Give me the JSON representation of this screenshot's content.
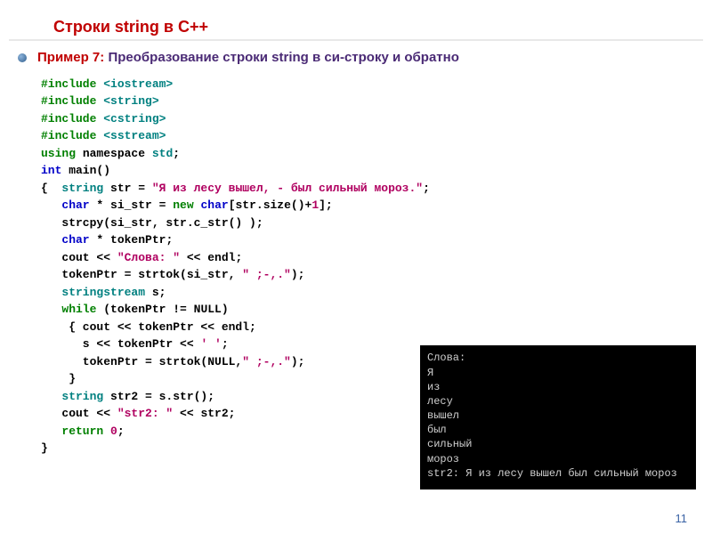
{
  "title": "Строки  string в С++",
  "example": {
    "label": "Пример 7: ",
    "text": "Преобразование строки string в си-строку и обратно"
  },
  "code": {
    "l1a": "#include ",
    "l1b": "<iostream>",
    "l2a": "#include ",
    "l2b": "<string>",
    "l3a": "#include ",
    "l3b": "<cstring>",
    "l4a": "#include ",
    "l4b": "<sstream>",
    "l5a": "using",
    "l5b": " namespace ",
    "l5c": "std",
    "l5d": ";",
    "l6a": "int",
    "l6b": " main()",
    "l7a": "{  ",
    "l7b": "string",
    "l7c": " str = ",
    "l7d": "\"Я из лесу вышел, - был сильный мороз.\"",
    "l7e": ";",
    "l8a": "   ",
    "l8b": "char",
    "l8c": " * si_str = ",
    "l8d": "new",
    "l8e": " ",
    "l8f": "char",
    "l8g": "[str.size()+",
    "l8h": "1",
    "l8i": "];",
    "l9a": "   strcpy(si_str, str.c_str() );",
    "l10a": "   ",
    "l10b": "char",
    "l10c": " * tokenPtr;",
    "l11a": "   cout << ",
    "l11b": "\"Слова: \"",
    "l11c": " << endl;",
    "l12a": "   tokenPtr = strtok(si_str, ",
    "l12b": "\" ;-,.\"",
    "l12c": ");",
    "l13a": "   ",
    "l13b": "stringstream",
    "l13c": " s;",
    "l14a": "   ",
    "l14b": "while",
    "l14c": " (tokenPtr != NULL)",
    "l15a": "    { cout << tokenPtr << endl;",
    "l16a": "      s << tokenPtr << ",
    "l16b": "' '",
    "l16c": ";",
    "l17a": "      tokenPtr = strtok(NULL,",
    "l17b": "\" ;-,.\"",
    "l17c": ");",
    "l18a": "    }",
    "l19a": "   ",
    "l19b": "string",
    "l19c": " str2 = s.str();",
    "l20a": "   cout << ",
    "l20b": "\"str2: \"",
    "l20c": " << str2;",
    "l21a": "   ",
    "l21b": "return",
    "l21c": " ",
    "l21d": "0",
    "l21e": ";",
    "l22a": "}"
  },
  "console": "Слова:\nЯ\nиз\nлесу\nвышел\nбыл\nсильный\nмороз\nstr2: Я из лесу вышел был сильный мороз",
  "pagenum": "11"
}
